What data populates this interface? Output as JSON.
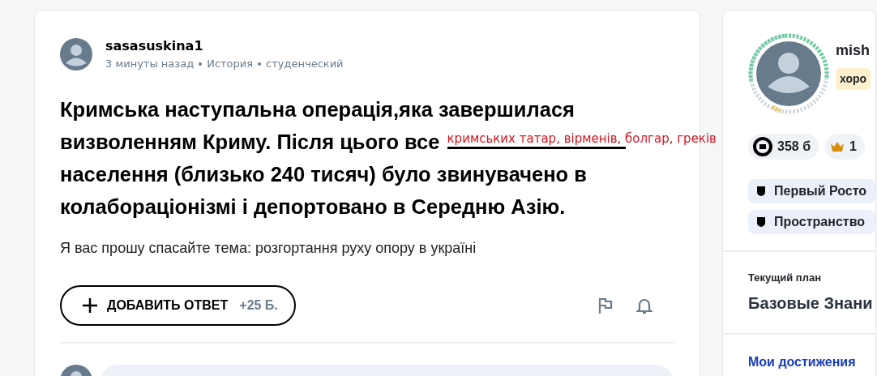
{
  "question": {
    "author": "sasasuskina1",
    "time": "3 минуты назад",
    "subject": "История",
    "level": "студенческий",
    "heading_before": "Кримська наступальна операція,яка завершилася визволенням Криму. Після цього все",
    "heading_after": "населення (близько 240 тисяч) було звинувачено в колабораціонізмі і депортовано в Середню Азію.",
    "handwritten_answer": "кримських татар, вірменів, болгар, греків",
    "body": "Я вас прошу спасайте тема: розгортання руху опору в україні",
    "answer_button": {
      "label": "ДОБАВИТЬ ОТВЕТ",
      "points": "+25 Б."
    }
  },
  "profile": {
    "name": "mish",
    "rank": "хоро",
    "points": "358 б",
    "crowns": "1",
    "badges": [
      "Первый Росто",
      "Пространство"
    ],
    "plan_label": "Текущий план",
    "plan": "Базовые Знани",
    "achievements": "Мои достижения"
  }
}
